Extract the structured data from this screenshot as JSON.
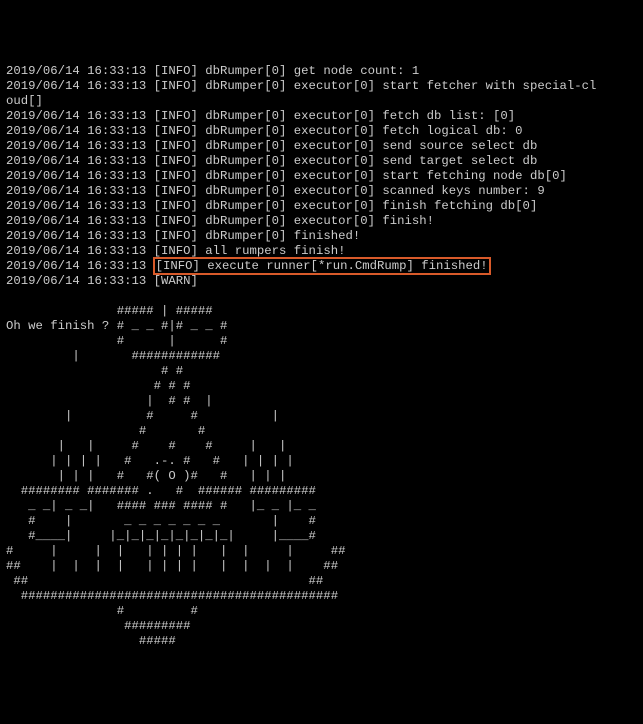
{
  "logs": [
    {
      "ts": "2019/06/14 16:33:13",
      "lvl": "[INFO]",
      "msg": "dbRumper[0] get node count: 1"
    },
    {
      "ts": "2019/06/14 16:33:13",
      "lvl": "[INFO]",
      "msg": "dbRumper[0] executor[0] start fetcher with special-cloud[]"
    },
    {
      "ts": "2019/06/14 16:33:13",
      "lvl": "[INFO]",
      "msg": "dbRumper[0] executor[0] fetch db list: [0]"
    },
    {
      "ts": "2019/06/14 16:33:13",
      "lvl": "[INFO]",
      "msg": "dbRumper[0] executor[0] fetch logical db: 0"
    },
    {
      "ts": "2019/06/14 16:33:13",
      "lvl": "[INFO]",
      "msg": "dbRumper[0] executor[0] send source select db"
    },
    {
      "ts": "2019/06/14 16:33:13",
      "lvl": "[INFO]",
      "msg": "dbRumper[0] executor[0] send target select db"
    },
    {
      "ts": "2019/06/14 16:33:13",
      "lvl": "[INFO]",
      "msg": "dbRumper[0] executor[0] start fetching node db[0]"
    },
    {
      "ts": "2019/06/14 16:33:13",
      "lvl": "[INFO]",
      "msg": "dbRumper[0] executor[0] scanned keys number: 9"
    },
    {
      "ts": "2019/06/14 16:33:13",
      "lvl": "[INFO]",
      "msg": "dbRumper[0] executor[0] finish fetching db[0]"
    },
    {
      "ts": "2019/06/14 16:33:13",
      "lvl": "[INFO]",
      "msg": "dbRumper[0] executor[0] finish!"
    },
    {
      "ts": "2019/06/14 16:33:13",
      "lvl": "[INFO]",
      "msg": "dbRumper[0] finished!"
    },
    {
      "ts": "2019/06/14 16:33:13",
      "lvl": "[INFO]",
      "msg": "all rumpers finish!"
    },
    {
      "ts": "2019/06/14 16:33:13",
      "lvl": "[INFO]",
      "msg": "execute runner[*run.CmdRump] finished!",
      "highlight": true
    },
    {
      "ts": "2019/06/14 16:33:13",
      "lvl": "[WARN]",
      "msg": ""
    }
  ],
  "art_prefix": "Oh we finish ? ",
  "ascii_art": "               ##### | #####\nOh we finish ? # _ _ #|# _ _ #\n               #      |      #\n         |       ############\n                     # #\n                    # # #\n                   |  # #  |\n        |          #     #          |\n                  #       #\n       |   |     #    #    #     |   |\n      | | | |   #   .-. #   #   | | | |\n       | | |   #   #( O )#   #   | | |\n  ######## ####### .   #  ###### #########\n   _ _| _ _|   #### ### #### #   |_ _ |_ _\n   #    |       _ _ _ _ _ _ _       |    #\n   #____|     |_|_|_|_|_|_|_|_|     |____#\n#     |     |  |   | | | |   |  |     |     ##\n##    |  |  |  |   | | | |   |  |  |  |    ##\n ##                                      ##\n  ###########################################\n               #         #\n                #########\n                  #####"
}
